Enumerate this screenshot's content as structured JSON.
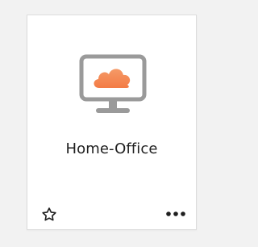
{
  "card": {
    "title": "Home-Office",
    "icon": "monitor-cloud-icon",
    "accent_color": "#f7834e",
    "monitor_color": "#9a9a9a"
  },
  "actions": {
    "favorite_icon": "star-outline-icon",
    "more_icon": "more-horizontal-icon"
  }
}
